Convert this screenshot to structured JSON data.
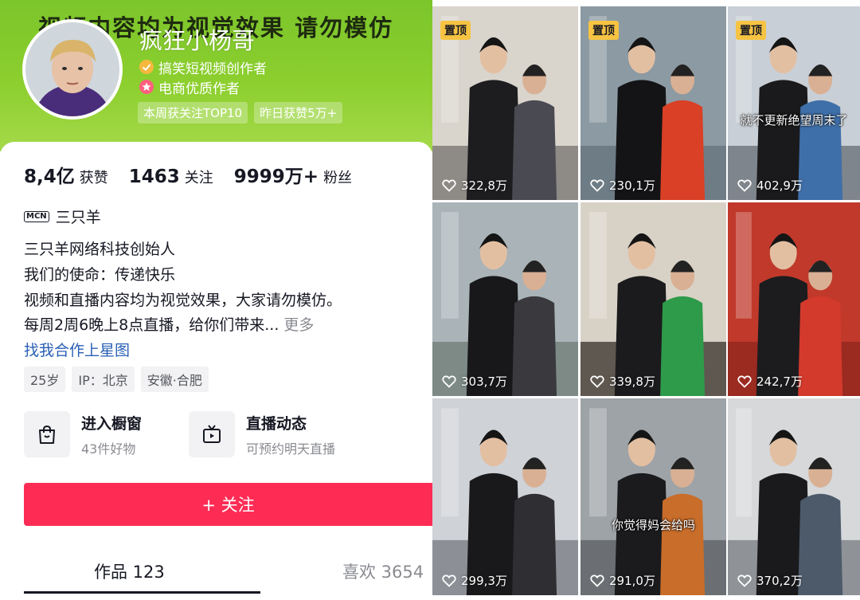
{
  "profile": {
    "banner_text": "视频内容均为视觉效果 请勿模仿",
    "name": "疯狂小杨哥",
    "cert_creator": "搞笑短视频创作者",
    "cert_ecommerce": "电商优质作者",
    "tags": [
      "本周获关注TOP10",
      "昨日获赞5万+"
    ],
    "stats": [
      {
        "value": "8,4亿",
        "label": "获赞"
      },
      {
        "value": "1463",
        "label": "关注"
      },
      {
        "value": "9999万+",
        "label": "粉丝"
      }
    ],
    "mcn_badge": "MCN",
    "mcn_name": "三只羊",
    "bio": [
      "三只羊网络科技创始人",
      "我们的使命：传递快乐",
      "视频和直播内容均为视觉效果，大家请勿模仿。",
      "每周2周6晚上8点直播，给你们带来..."
    ],
    "more_label": "更多",
    "cooperation_link": "找我合作上星图",
    "chips": [
      "25岁",
      "IP：北京",
      "安徽·合肥"
    ],
    "features": [
      {
        "title": "进入橱窗",
        "subtitle": "43件好物",
        "icon": "shopping-bag-icon"
      },
      {
        "title": "直播动态",
        "subtitle": "可预约明天直播",
        "icon": "tv-icon"
      }
    ],
    "follow_label": "+ 关注",
    "tabs": {
      "works": "作品 123",
      "likes": "喜欢 3654"
    },
    "colors": {
      "banner": "#8ccf2e",
      "follow": "#fe2c55",
      "link": "#2a5fb5",
      "pin": "#f6c342"
    }
  },
  "videos": [
    {
      "pinned": true,
      "pin_label": "置顶",
      "likes": "322,8万",
      "caption": ""
    },
    {
      "pinned": true,
      "pin_label": "置顶",
      "likes": "230,1万",
      "caption": ""
    },
    {
      "pinned": true,
      "pin_label": "置顶",
      "likes": "402,9万",
      "caption": "就不更新绝望周末了"
    },
    {
      "pinned": false,
      "pin_label": "",
      "likes": "303,7万",
      "caption": ""
    },
    {
      "pinned": false,
      "pin_label": "",
      "likes": "339,8万",
      "caption": ""
    },
    {
      "pinned": false,
      "pin_label": "",
      "likes": "242,7万",
      "caption": ""
    },
    {
      "pinned": false,
      "pin_label": "",
      "likes": "299,3万",
      "caption": ""
    },
    {
      "pinned": false,
      "pin_label": "",
      "likes": "291,0万",
      "caption": "你觉得妈会给吗"
    },
    {
      "pinned": false,
      "pin_label": "",
      "likes": "370,2万",
      "caption": ""
    }
  ]
}
